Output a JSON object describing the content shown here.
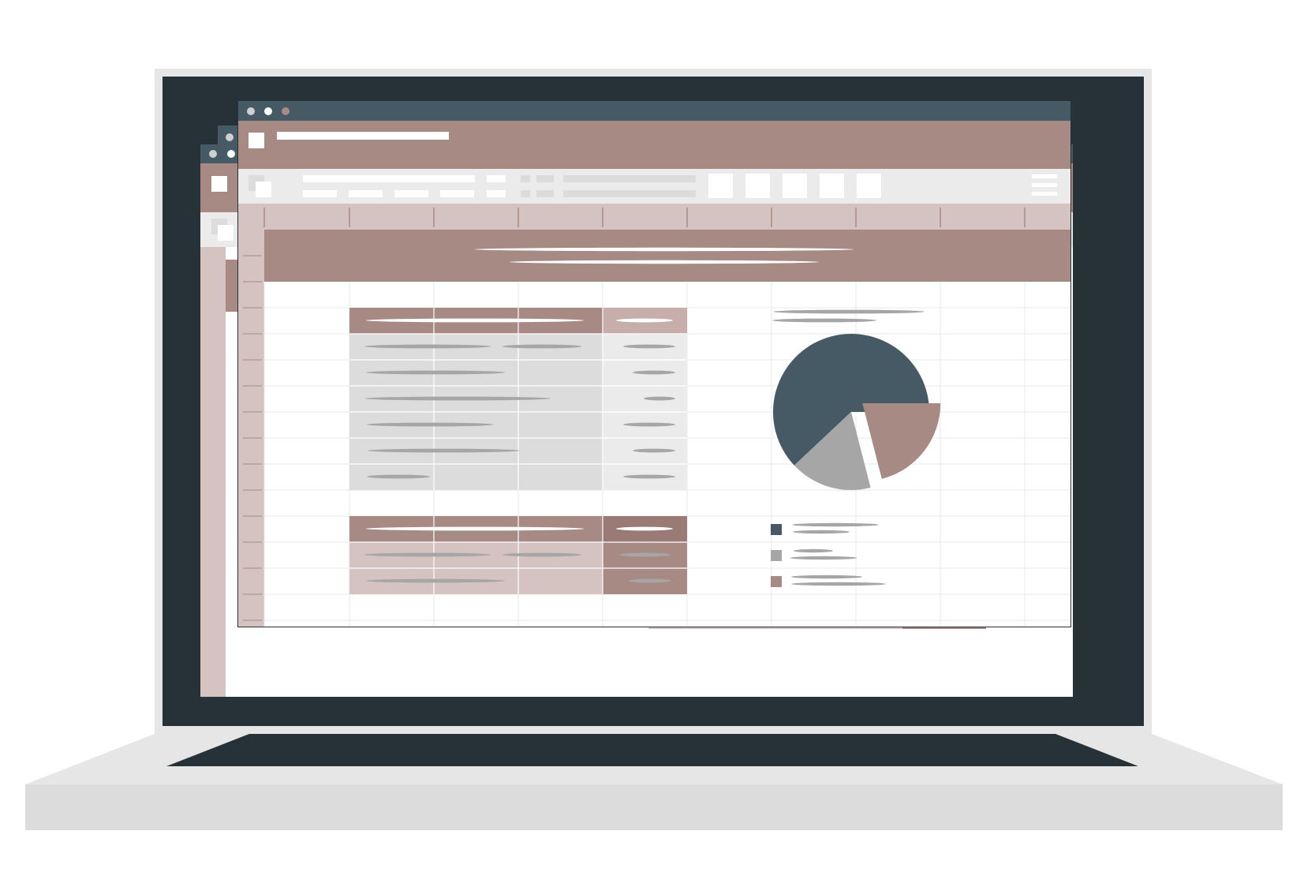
{
  "colors": {
    "bezel": "#e6e6e6",
    "screen": "#263238",
    "titlebar": "#455a64",
    "accent": "#a88a85",
    "accent_light": "#d4c3c1",
    "accent_dark": "#9a7a75",
    "toolbar": "#ebebeb",
    "cell_gray": "#dcdcdc",
    "cell_gray_light": "#ebebeb",
    "placeholder_gray": "#a6a6a6",
    "base_top": "#e6e6e6",
    "base_front": "#dcdcdc",
    "sheet": "#ffffff"
  },
  "window_controls": [
    "close-dot",
    "minimize-dot",
    "maximize-dot"
  ],
  "toolbar_icons": [
    "tool-button-1",
    "tool-button-2",
    "tool-button-3",
    "tool-button-4",
    "tool-button-5",
    "hamburger-menu-icon"
  ],
  "chart_data": {
    "type": "pie",
    "values": [
      62,
      17,
      21
    ],
    "colors": [
      "#455a64",
      "#a6a6a6",
      "#a88a85"
    ],
    "exploded": [
      false,
      false,
      true
    ]
  }
}
